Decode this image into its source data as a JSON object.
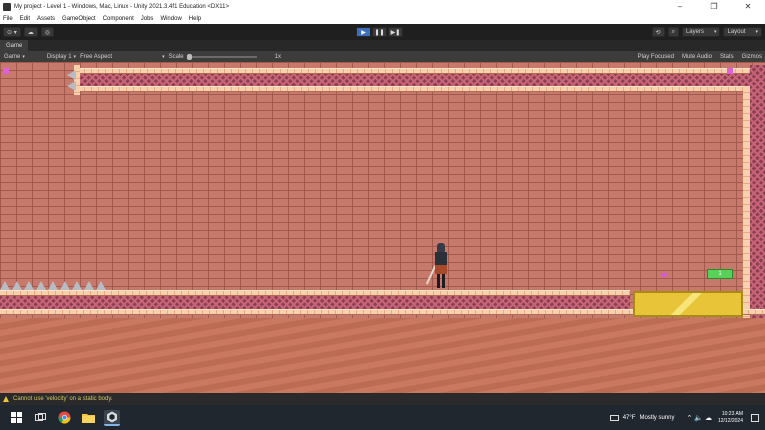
{
  "window": {
    "title": "My project - Level 1 - Windows, Mac, Linux - Unity 2021.3.4f1 Education <DX11>",
    "minimize_glyph": "–",
    "maximize_glyph": "❐",
    "close_glyph": "✕"
  },
  "menu": [
    "File",
    "Edit",
    "Assets",
    "GameObject",
    "Component",
    "Jobs",
    "Window",
    "Help"
  ],
  "toolbar": {
    "account_label": "⊙ ▾",
    "cloud_label": "☁",
    "collab_label": "◎",
    "play_glyph": "▶",
    "pause_glyph": "❚❚",
    "step_glyph": "▶❚",
    "history_glyph": "⟲",
    "search_glyph": "⌕",
    "layers_label": "Layers",
    "layout_label": "Layout"
  },
  "game_tab": {
    "label": "Game"
  },
  "game_bar": {
    "mode": "Game",
    "display": "Display 1",
    "aspect": "Free Aspect",
    "scale_label": "Scale",
    "scale_value": "1x",
    "play_focused": "Play Focused",
    "mute_audio": "Mute Audio",
    "stats": "Stats",
    "gizmos": "Gizmos"
  },
  "scene": {
    "green_tag_text": "1"
  },
  "status": {
    "message": "Cannot use 'velocity' on a static body."
  },
  "taskbar": {
    "weather_temp": "47°F",
    "weather_text": "Mostly sunny",
    "time": "10:23 AM",
    "date": "12/12/2024",
    "sys_icons": "⌃ 🔈 ☁"
  },
  "colors": {
    "accent": "#3c6dbf",
    "brick": "#c77a6b",
    "gold": "#e8c438",
    "warning": "#d6c46a"
  }
}
